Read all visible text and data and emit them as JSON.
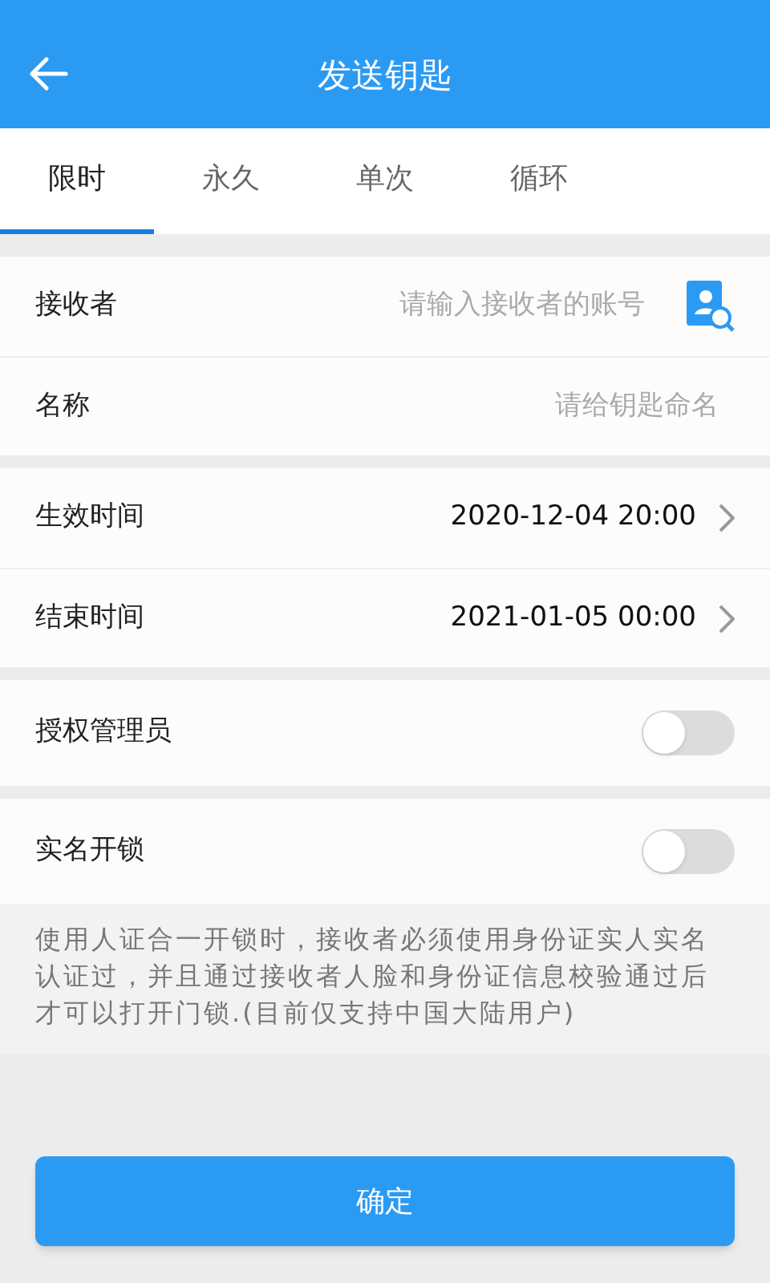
{
  "header": {
    "title": "发送钥匙"
  },
  "tabs": [
    {
      "label": "限时",
      "selected": true
    },
    {
      "label": "永久",
      "selected": false
    },
    {
      "label": "单次",
      "selected": false
    },
    {
      "label": "循环",
      "selected": false
    }
  ],
  "inputs": [
    {
      "label": "接收者",
      "placeholder": "请输入接收者的账号",
      "contact_picker": true
    },
    {
      "label": "名称",
      "placeholder": "请给钥匙命名",
      "contact_picker": false
    }
  ],
  "times": [
    {
      "label": "生效时间",
      "value": "2020-12-04 20:00"
    },
    {
      "label": "结束时间",
      "value": "2021-01-05 00:00"
    }
  ],
  "toggles": [
    {
      "label": "授权管理员",
      "on": false
    },
    {
      "label": "实名开锁",
      "on": false
    }
  ],
  "note": "使用人证合一开锁时，接收者必须使用身份证实人实名认证过，并且通过接收者人脸和身份证信息校验通过后才可以打开门锁.(目前仅支持中国大陆用户)",
  "confirm_button": "确定"
}
